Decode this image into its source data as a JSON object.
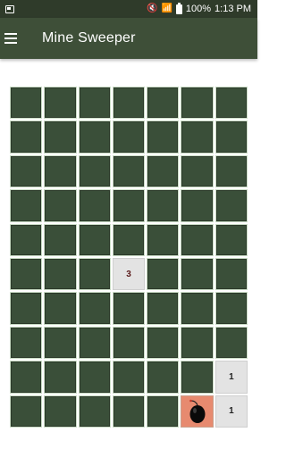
{
  "status_bar": {
    "battery": "100%",
    "time": "1:13 PM"
  },
  "app_bar": {
    "title": "Mine Sweeper",
    "menu_icon": "menu-icon"
  },
  "board": {
    "columns": 7,
    "rows": 10,
    "cells": [
      [
        "hidden",
        "hidden",
        "hidden",
        "hidden",
        "hidden",
        "hidden",
        "hidden"
      ],
      [
        "hidden",
        "hidden",
        "hidden",
        "hidden",
        "hidden",
        "hidden",
        "hidden"
      ],
      [
        "hidden",
        "hidden",
        "hidden",
        "hidden",
        "hidden",
        "hidden",
        "hidden"
      ],
      [
        "hidden",
        "hidden",
        "hidden",
        "hidden",
        "hidden",
        "hidden",
        "hidden"
      ],
      [
        "hidden",
        "hidden",
        "hidden",
        "hidden",
        "hidden",
        "hidden",
        "hidden"
      ],
      [
        "hidden",
        "hidden",
        "hidden",
        "3",
        "hidden",
        "hidden",
        "hidden"
      ],
      [
        "hidden",
        "hidden",
        "hidden",
        "hidden",
        "hidden",
        "hidden",
        "hidden"
      ],
      [
        "hidden",
        "hidden",
        "hidden",
        "hidden",
        "hidden",
        "hidden",
        "hidden"
      ],
      [
        "hidden",
        "hidden",
        "hidden",
        "hidden",
        "hidden",
        "hidden",
        "1"
      ],
      [
        "hidden",
        "hidden",
        "hidden",
        "hidden",
        "hidden",
        "mine",
        "1"
      ]
    ],
    "colors": {
      "hidden": "#3a4f39",
      "revealed": "#e3e3e3",
      "mine": "#e78a6f"
    }
  }
}
